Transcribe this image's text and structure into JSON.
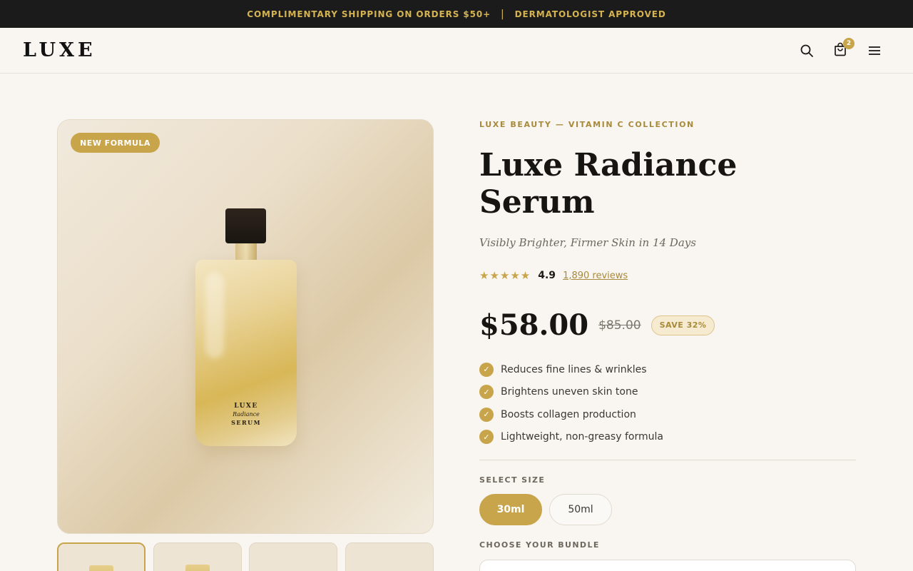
{
  "announcement": {
    "left": "COMPLIMENTARY SHIPPING ON ORDERS $50+",
    "separator": "|",
    "right": "DERMATOLOGIST APPROVED"
  },
  "header": {
    "logo": "LUXE",
    "cart_count": "2",
    "icons": [
      "search-icon",
      "bag-icon",
      "menu-icon"
    ]
  },
  "gallery": {
    "badge": "NEW FORMULA",
    "bottle_label": {
      "line1": "LUXE",
      "line2": "Radiance",
      "line3": "SERUM"
    },
    "thumbnail_count": 4,
    "active_thumbnail": 0
  },
  "product": {
    "eyebrow": "LUXE BEAUTY — VITAMIN C COLLECTION",
    "title": "Luxe Radiance Serum",
    "subtitle": "Visibly Brighter, Firmer Skin in 14 Days",
    "stars": "★★★★★",
    "rating": "4.9",
    "reviews": "1,890 reviews",
    "price": "$58.00",
    "old_price": "$85.00",
    "save": "SAVE 32%",
    "benefits": [
      "Reduces fine lines & wrinkles",
      "Brightens uneven skin tone",
      "Boosts collagen production",
      "Lightweight, non-greasy formula"
    ],
    "size_label": "SELECT SIZE",
    "sizes": [
      "30ml",
      "50ml"
    ],
    "selected_size": "30ml",
    "bundle_label": "CHOOSE YOUR BUNDLE"
  },
  "colors": {
    "accent": "#c8a44a",
    "announcement_bg": "#1b1b1b",
    "page_bg": "#f9f6f1"
  }
}
